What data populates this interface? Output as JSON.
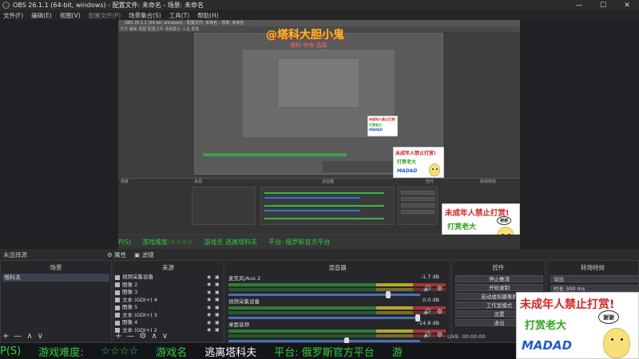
{
  "window": {
    "title": "OBS 26.1.1 (64-bit, windows) - 配置文件: 未命名 - 场景: 未命名",
    "minimize": "—",
    "maximize": "☐",
    "close": "✕"
  },
  "menu": {
    "items": [
      "文件(F)",
      "编辑(E)",
      "视图(V)",
      "配置文件(P)",
      "场景集合(S)",
      "工具(T)",
      "帮助(H)"
    ],
    "dim_index": 3
  },
  "preview": {
    "overlay_title": "@塔科大胆小鬼",
    "overlay_sub": "塔科 夺命 逃离",
    "inner_title": "OBS 26.1.1 (64-bit, windows) - 配置文件: 未命名 - 场景: 未命名",
    "inner_menu": "文件 编辑 视图 配置文件 场景集合 工具 帮助",
    "inner_tabs": [
      "场景",
      "来源",
      "混音器",
      "转场特效",
      "控件"
    ],
    "ticker_segments": [
      "P(S)",
      "游戏难度:☆☆☆☆",
      "游戏名 逃离塔科夫",
      "平台: 俄罗斯官方平台"
    ]
  },
  "cards": {
    "big": {
      "line1": "未成年人禁止打赏!",
      "line2": "打赏老大",
      "logo": "MADAD",
      "bubble": "谢谢"
    },
    "mid": {
      "line1": "未成年人禁止打赏!",
      "line2": "打赏老大",
      "logo": "MADAD",
      "bubble": "谢谢"
    },
    "small": {
      "line1": "未成年人禁止打赏!",
      "line2": "打赏老大",
      "logo": "MADAD"
    }
  },
  "docks": {
    "header_left": "未选择源",
    "header_tabs": [
      {
        "icon": "⚙",
        "label": "属性"
      },
      {
        "icon": "▣",
        "label": "滤镜"
      }
    ],
    "scenes": {
      "title": "场景",
      "items": [
        "塔科夫"
      ],
      "toolbar": [
        "+",
        "—",
        "∧",
        "∨"
      ]
    },
    "sources": {
      "title": "来源",
      "items": [
        "视频采集设备",
        "图像 2",
        "图像 3",
        "文本 (GDI+) 4",
        "图像 5",
        "文本 (GDI+) 3",
        "图像 4",
        "文本 (GDI+) 2"
      ],
      "toolbar": [
        "+",
        "—",
        "⚙",
        "∧",
        "∨"
      ]
    },
    "mixer": {
      "title": "混音器",
      "tracks": [
        {
          "name": "麦克风/Aux 2",
          "db": "-1.7 dB",
          "level": 0.84
        },
        {
          "name": "视频采集设备",
          "db": "0.0 dB",
          "level": 1.0
        },
        {
          "name": "桌面音频",
          "db": "-14.8 dB",
          "level": 0.62
        }
      ]
    },
    "controls": {
      "title": "控件",
      "buttons": [
        "停止推流",
        "开始录制",
        "启动虚拟摄像机",
        "工作室模式",
        "设置",
        "退出"
      ]
    },
    "transitions": {
      "title": "转场特效",
      "rows": [
        "淡出",
        "时长 300 ms"
      ]
    }
  },
  "status": {
    "text": "LIVE: 00:00:00"
  },
  "ticker": {
    "segments": [
      {
        "text": "P(S)",
        "white": false
      },
      {
        "text": "游戏难度:",
        "white": false
      },
      {
        "text": "☆☆☆☆",
        "white": false
      },
      {
        "text": "游戏名",
        "white": false
      },
      {
        "text": "逃离塔科夫",
        "white": true
      },
      {
        "text": "平台: 俄罗斯官方平台",
        "white": false
      },
      {
        "text": "游",
        "white": false
      }
    ]
  },
  "colors": {
    "accent_green": "#2ecc40",
    "card_red": "#e02020",
    "card_green": "#2aa61a",
    "logo_blue": "#1e5bd8",
    "slider_blue": "#4a6fb3"
  }
}
